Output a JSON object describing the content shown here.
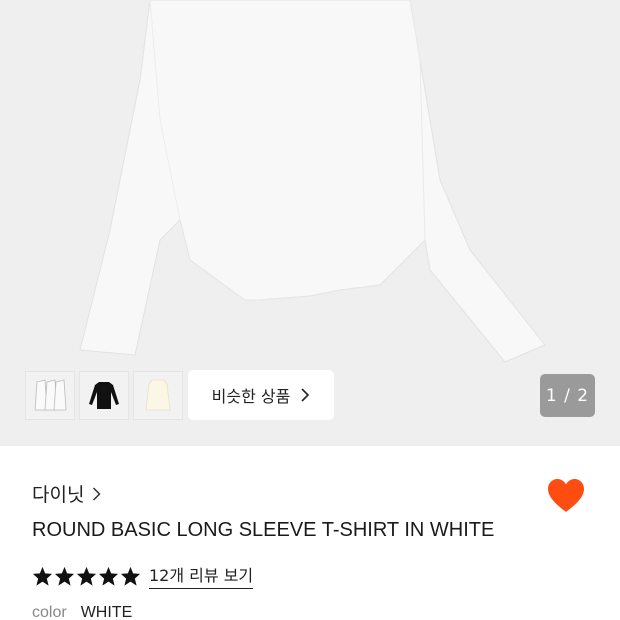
{
  "gallery": {
    "thumbnails": [
      {
        "icon": "white-tshirt-set-thumbnail"
      },
      {
        "icon": "black-tshirt-thumbnail"
      },
      {
        "icon": "ivory-tshirt-thumbnail"
      }
    ],
    "similar_button_label": "비슷한 상품",
    "pager_text": "1 / 2"
  },
  "product": {
    "brand": "다이닛",
    "title": "ROUND BASIC LONG SLEEVE T-SHIRT IN WHITE",
    "rating_stars": 5,
    "review_link": "12개 리뷰 보기",
    "color_label": "color",
    "color_value": "WHITE",
    "wishlisted": true
  },
  "colors": {
    "gallery_bg": "#efefef",
    "heart": "#ff4d12",
    "star": "#111111"
  }
}
